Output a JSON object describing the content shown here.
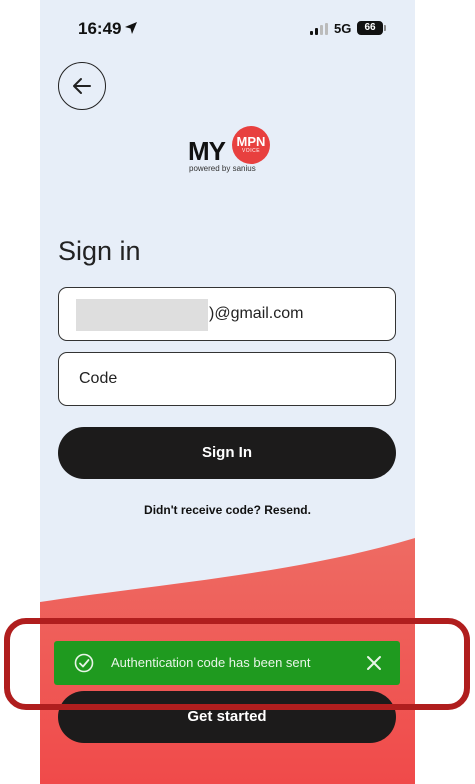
{
  "status_bar": {
    "time": "16:49",
    "network": "5G",
    "battery": "66",
    "icons": [
      "location-arrow-icon",
      "signal-bars-icon",
      "battery-icon"
    ]
  },
  "header": {
    "back_icon": "arrow-left-icon",
    "logo": {
      "my": "MY",
      "mpn": "MPN",
      "voice": "VOICE",
      "powered_by": "powered by sanius"
    }
  },
  "form": {
    "title": "Sign in",
    "email_value": ")@gmail.com",
    "code_placeholder": "Code",
    "sign_in_label": "Sign In",
    "resend_text": "Didn't receive code? Resend."
  },
  "footer": {
    "get_started_label": "Get started"
  },
  "toast": {
    "message": "Authentication code has been sent",
    "icons": [
      "check-circle-icon",
      "close-icon"
    ]
  },
  "colors": {
    "background": "#e7eef8",
    "accent": "#e8403f",
    "dark_button": "#1c1b1b",
    "toast": "#1f9a1f",
    "highlight": "#b01e1e"
  }
}
